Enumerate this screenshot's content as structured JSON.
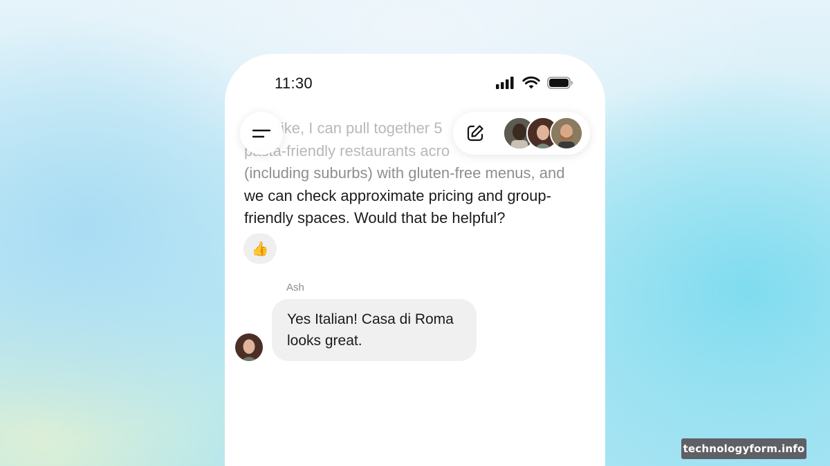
{
  "status_bar": {
    "time": "11:30",
    "icons": [
      "signal-icon",
      "wifi-icon",
      "battery-icon"
    ]
  },
  "header": {
    "menu_icon": "menu-icon",
    "compose_icon": "compose-icon",
    "participants": [
      "participant-1",
      "participant-2",
      "participant-3"
    ]
  },
  "messages": {
    "assistant": {
      "line1_faded": "like, I can pull together 5",
      "line2_faded": "pasta-friendly restaurants acro",
      "line3_mid": "(including suburbs) with gluten-free menus, and",
      "line4": "we can check approximate pricing and group-",
      "line5": "friendly spaces. Would that be helpful?",
      "reaction": "👍"
    },
    "user": {
      "sender": "Ash",
      "text": "Yes Italian! Casa di Roma looks great."
    }
  },
  "watermark": "technologyform.info",
  "colors": {
    "accent_bg": "#a9e4f3",
    "bubble_bg": "#f0f0f0",
    "watermark_bg": "#5e6066"
  }
}
